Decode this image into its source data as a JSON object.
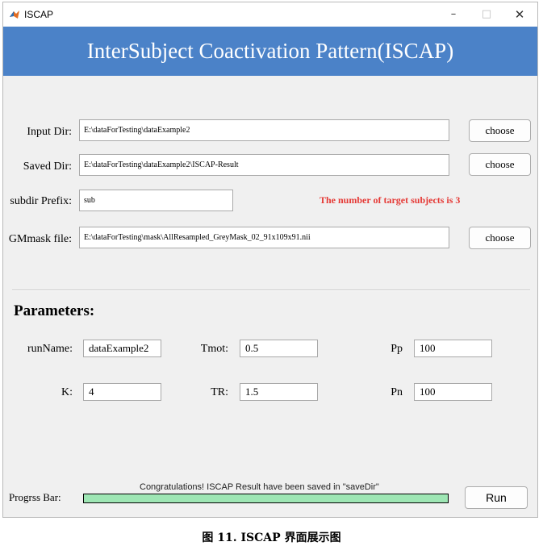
{
  "window": {
    "title": "ISCAP",
    "controls": {
      "minimize": "–",
      "maximize": "□",
      "close": "✕"
    },
    "app_icon": "matlab-icon"
  },
  "banner": {
    "title": "InterSubject Coactivation Pattern(ISCAP)"
  },
  "paths": {
    "input_dir": {
      "label": "Input Dir:",
      "value": "E:\\dataForTesting\\dataExample2",
      "button": "choose"
    },
    "saved_dir": {
      "label": "Saved Dir:",
      "value": "E:\\dataForTesting\\dataExample2\\ISCAP-Result",
      "button": "choose"
    },
    "subdir_prefix": {
      "label": "subdir Prefix:",
      "value": "sub"
    },
    "subjects_message": "The number of target subjects is 3",
    "gm_mask": {
      "label": "GMmask file:",
      "value": "E:\\dataForTesting\\mask\\AllResampled_GreyMask_02_91x109x91.nii",
      "button": "choose"
    }
  },
  "parameters": {
    "heading": "Parameters:",
    "run_name": {
      "label": "runName:",
      "value": "dataExample2"
    },
    "tmot": {
      "label": "Tmot:",
      "value": "0.5"
    },
    "pp": {
      "label": "Pp",
      "value": "100"
    },
    "k": {
      "label": "K:",
      "value": "4"
    },
    "tr": {
      "label": "TR:",
      "value": "1.5"
    },
    "pn": {
      "label": "Pn",
      "value": "100"
    }
  },
  "status": {
    "message": "Congratulations! ISCAP Result have been saved in \"saveDir\"",
    "progress_label": "Progrss Bar:",
    "progress_fraction": 1.0,
    "progress_color": "#9ee6b4",
    "run_button": "Run"
  },
  "caption": "图 11. ISCAP 界面展示图",
  "colors": {
    "banner": "#4b82c8",
    "warning_text": "#e53935",
    "background": "#f0f0f0"
  }
}
